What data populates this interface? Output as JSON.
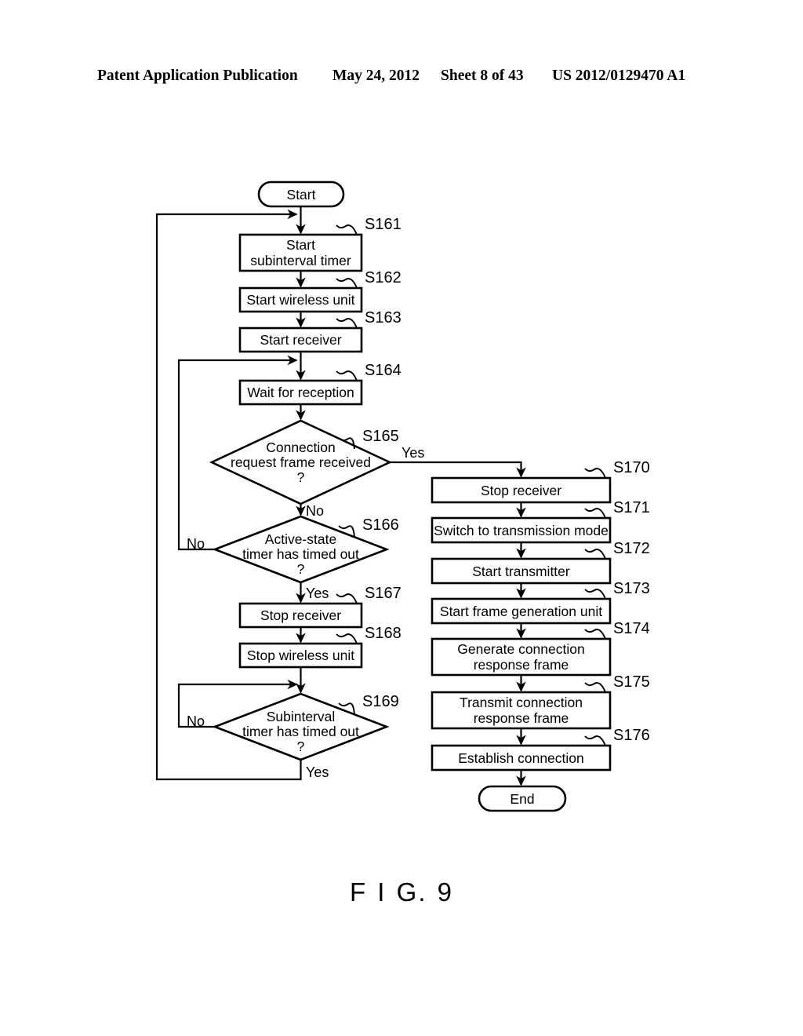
{
  "header": {
    "publication": "Patent Application Publication",
    "date": "May 24, 2012",
    "sheet": "Sheet 8 of 43",
    "number": "US 2012/0129470 A1"
  },
  "figure": {
    "caption": "F I G. 9"
  },
  "flowchart": {
    "start_label": "Start",
    "end_label": "End",
    "branch_yes": "Yes",
    "branch_no": "No",
    "nodes": [
      {
        "id": "start",
        "step": "",
        "type": "terminator",
        "text": "Start"
      },
      {
        "id": "s161",
        "step": "S161",
        "type": "process",
        "text": "Start subinterval timer",
        "line1": "Start",
        "line2": "subinterval timer"
      },
      {
        "id": "s162",
        "step": "S162",
        "type": "process",
        "text": "Start wireless unit"
      },
      {
        "id": "s163",
        "step": "S163",
        "type": "process",
        "text": "Start receiver"
      },
      {
        "id": "s164",
        "step": "S164",
        "type": "process",
        "text": "Wait for reception"
      },
      {
        "id": "s165",
        "step": "S165",
        "type": "decision",
        "text": "Connection request frame received ?",
        "line1": "Connection",
        "line2": "request frame received",
        "line3": "?"
      },
      {
        "id": "s166",
        "step": "S166",
        "type": "decision",
        "text": "Active-state timer has timed out ?",
        "line1": "Active-state",
        "line2": "timer has timed out",
        "line3": "?"
      },
      {
        "id": "s167",
        "step": "S167",
        "type": "process",
        "text": "Stop receiver"
      },
      {
        "id": "s168",
        "step": "S168",
        "type": "process",
        "text": "Stop wireless unit"
      },
      {
        "id": "s169",
        "step": "S169",
        "type": "decision",
        "text": "Subinterval timer has timed out ?",
        "line1": "Subinterval",
        "line2": "timer has timed out",
        "line3": "?"
      },
      {
        "id": "s170",
        "step": "S170",
        "type": "process",
        "text": "Stop receiver"
      },
      {
        "id": "s171",
        "step": "S171",
        "type": "process",
        "text": "Switch to transmission mode"
      },
      {
        "id": "s172",
        "step": "S172",
        "type": "process",
        "text": "Start transmitter"
      },
      {
        "id": "s173",
        "step": "S173",
        "type": "process",
        "text": "Start frame generation unit"
      },
      {
        "id": "s174",
        "step": "S174",
        "type": "process",
        "text": "Generate connection response frame",
        "line1": "Generate connection",
        "line2": "response frame"
      },
      {
        "id": "s175",
        "step": "S175",
        "type": "process",
        "text": "Transmit connection response frame",
        "line1": "Transmit connection",
        "line2": "response frame"
      },
      {
        "id": "s176",
        "step": "S176",
        "type": "process",
        "text": "Establish connection"
      },
      {
        "id": "end",
        "step": "",
        "type": "terminator",
        "text": "End"
      }
    ],
    "edge_labels": {
      "s165_yes": "Yes",
      "s165_no": "No",
      "s166_yes": "Yes",
      "s166_no": "No",
      "s169_yes": "Yes",
      "s169_no": "No"
    }
  }
}
